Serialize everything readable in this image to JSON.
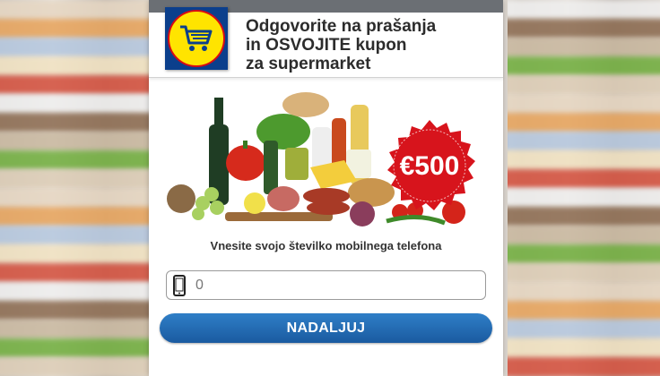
{
  "header": {
    "title_line1": "Odgovorite na prašanja",
    "title_line2": "in OSVOJITE kupon",
    "title_line3": "za supermarket"
  },
  "prize": {
    "amount": "€500",
    "color": "#d7141c"
  },
  "form": {
    "prompt": "Vnesite svojo številko mobilnega telefona",
    "phone_value": "0",
    "submit_label": "NADALJUJ",
    "button_color": "#1f66b0"
  },
  "icons": {
    "logo": "shopping-cart-icon",
    "phone": "mobile-phone-icon"
  }
}
